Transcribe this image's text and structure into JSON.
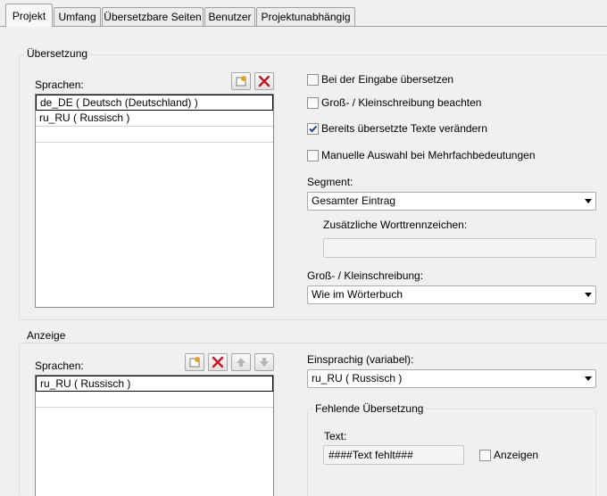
{
  "tabs": [
    {
      "label": "Projekt"
    },
    {
      "label": "Umfang"
    },
    {
      "label": "Übersetzbare Seiten"
    },
    {
      "label": "Benutzer"
    },
    {
      "label": "Projektunabhängig"
    }
  ],
  "uebersetzung": {
    "legend": "Übersetzung",
    "sprachen_label": "Sprachen:",
    "languages": [
      "de_DE ( Deutsch (Deutschland) )",
      "ru_RU ( Russisch )"
    ],
    "selected_index": 0,
    "options": [
      {
        "label": "Bei der Eingabe übersetzen",
        "checked": false
      },
      {
        "label": "Groß- / Kleinschreibung beachten",
        "checked": false
      },
      {
        "label": "Bereits übersetzte Texte verändern",
        "checked": true
      },
      {
        "label": "Manuelle Auswahl bei Mehrfachbedeutungen",
        "checked": false
      }
    ],
    "segment_label": "Segment:",
    "segment_value": "Gesamter Eintrag",
    "zusatz_label": "Zusätzliche Worttrennzeichen:",
    "zusatz_value": "",
    "case_label": "Groß- / Kleinschreibung:",
    "case_value": "Wie im Wörterbuch"
  },
  "anzeige": {
    "legend": "Anzeige",
    "sprachen_label": "Sprachen:",
    "languages": [
      "ru_RU ( Russisch )"
    ],
    "selected_index": 0,
    "einsprachig_label": "Einsprachig (variabel):",
    "einsprachig_value": "ru_RU ( Russisch )",
    "fehlend_legend": "Fehlende Übersetzung",
    "text_label": "Text:",
    "text_value": "####Text fehlt###",
    "anzeigen_label": "Anzeigen",
    "anzeigen_checked": false
  },
  "colors": {
    "check": "#1c3f95",
    "delete": "#c8141e",
    "add": "#e8a020"
  }
}
